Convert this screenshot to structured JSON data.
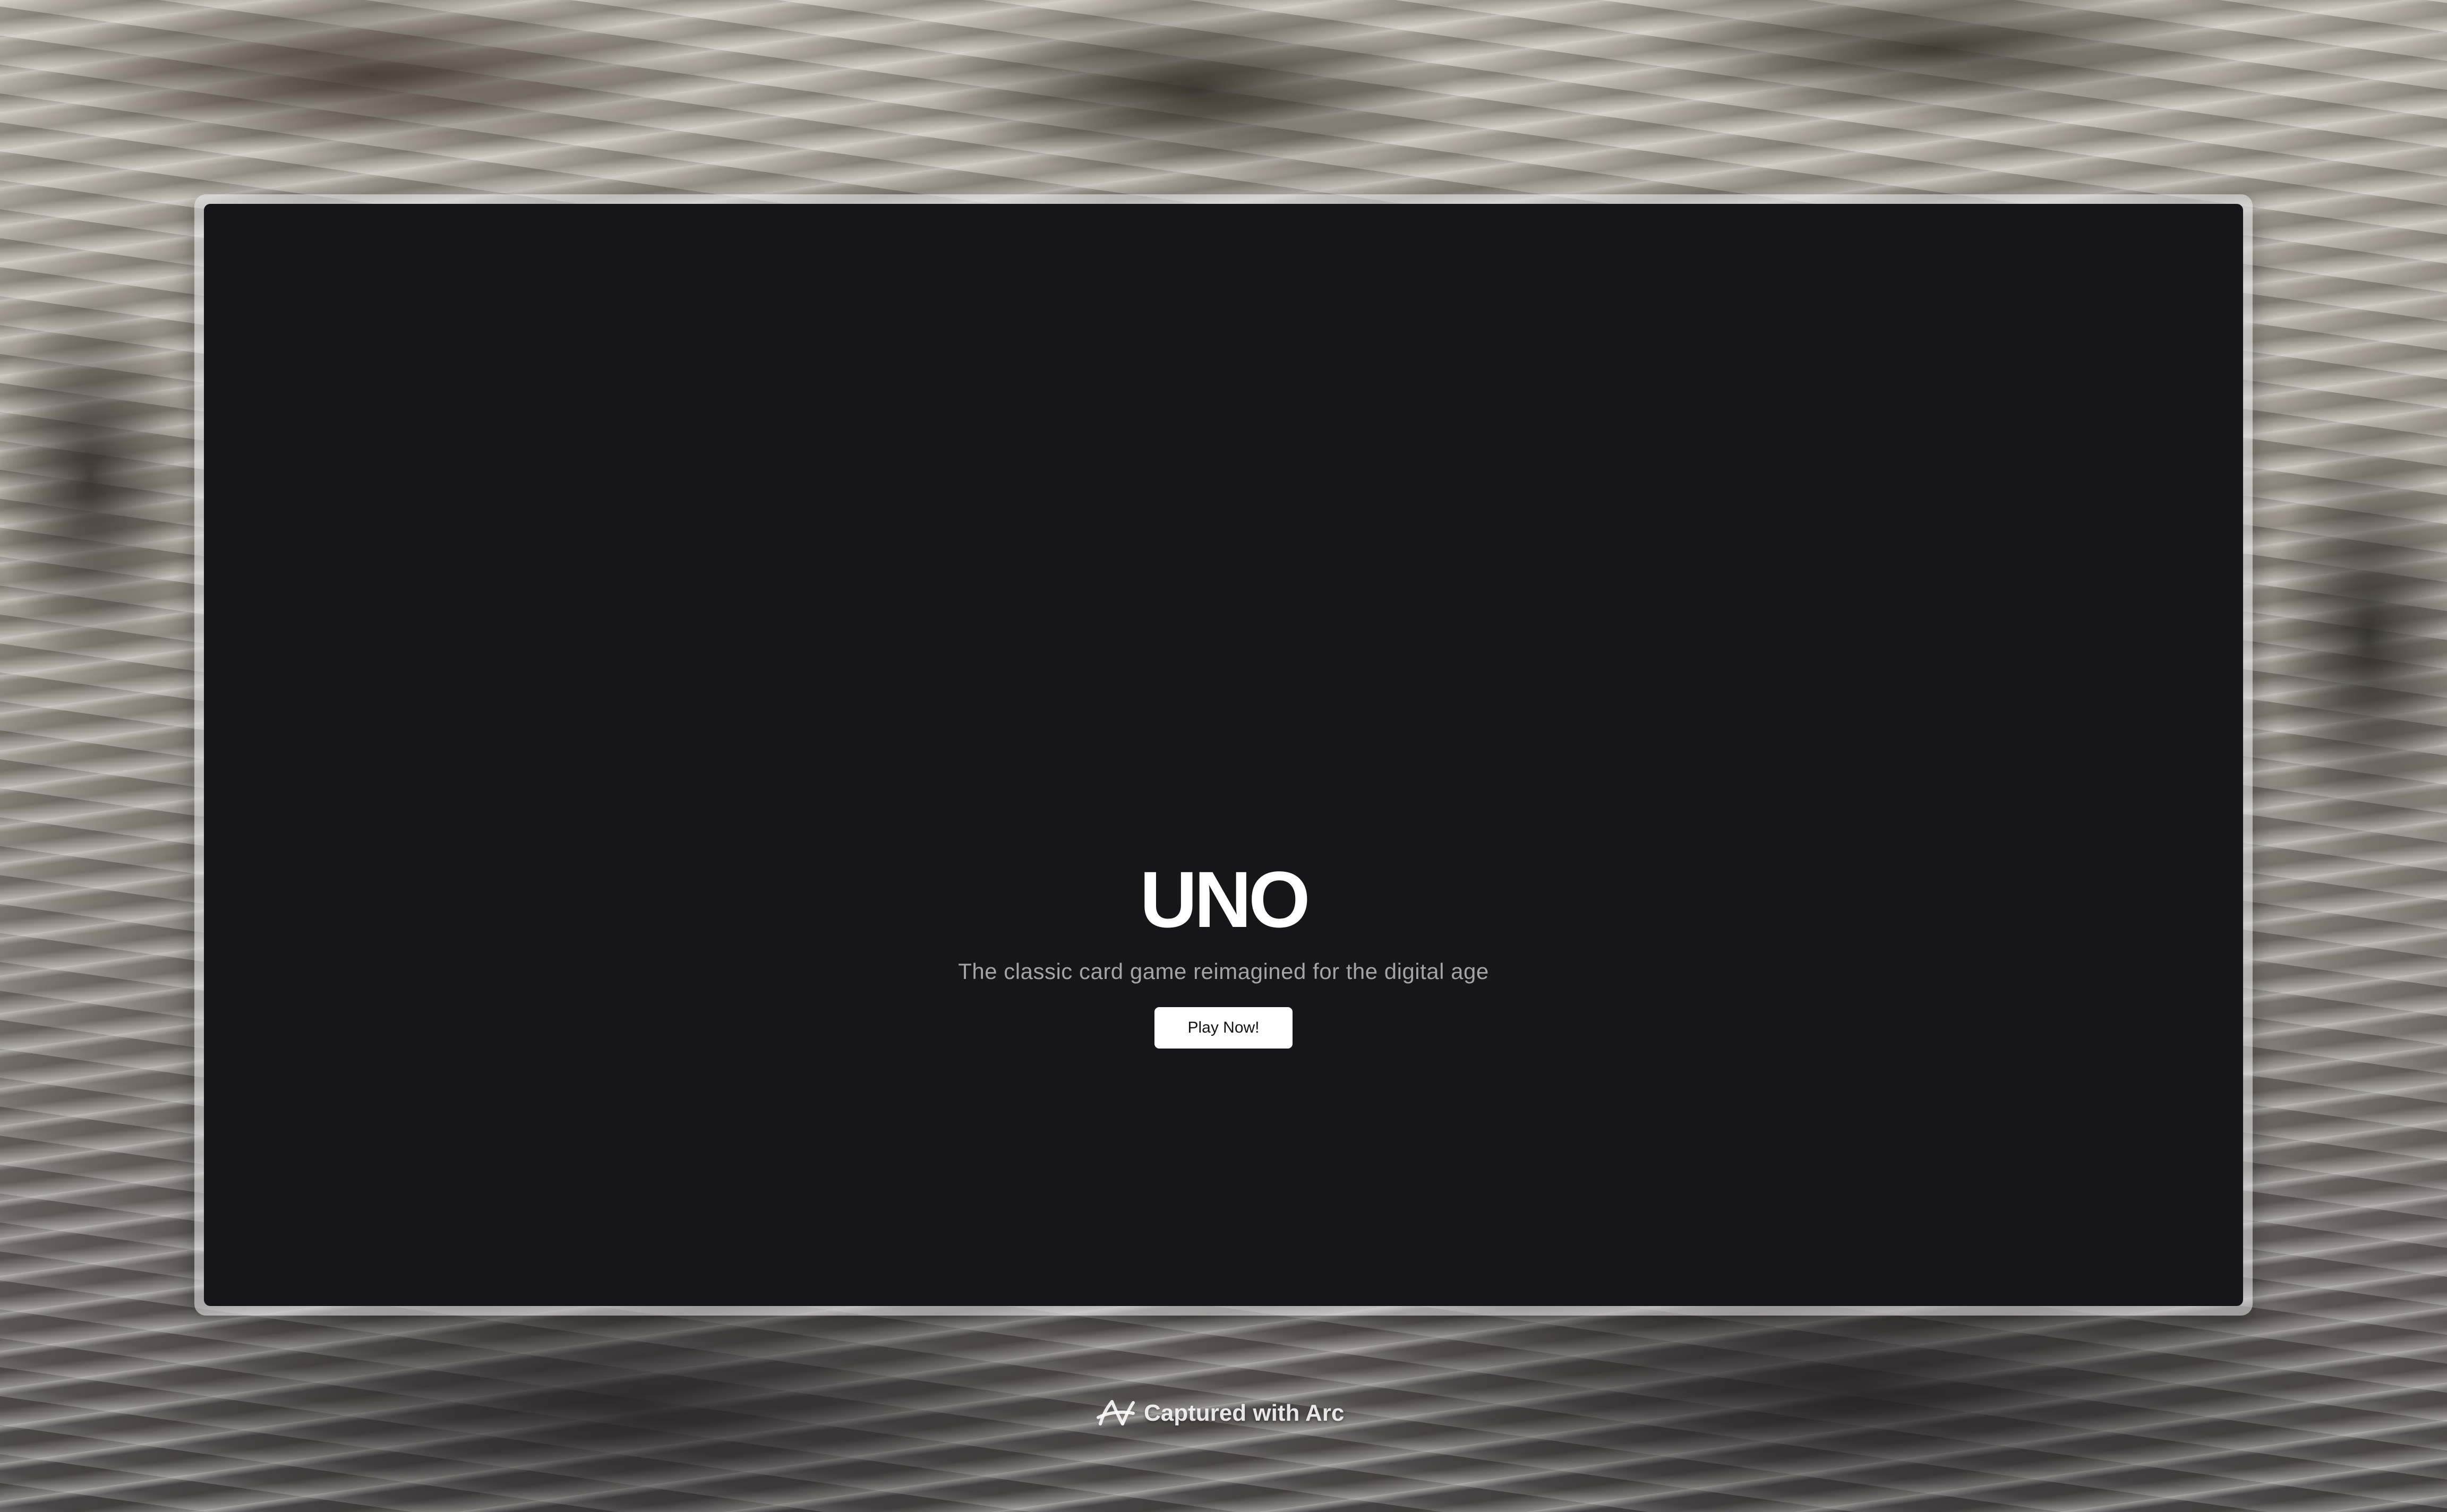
{
  "app": {
    "title": "UNO",
    "subtitle": "The classic card game reimagined for the digital age",
    "primary_action_label": "Play Now!"
  },
  "footer": {
    "caption": "Captured with Arc",
    "icon": "arc-logo-icon"
  },
  "colors": {
    "window_background": "#161618",
    "title_text": "#ffffff",
    "subtitle_text": "#a3a3a8",
    "button_background": "#ffffff",
    "button_text": "#111111"
  }
}
